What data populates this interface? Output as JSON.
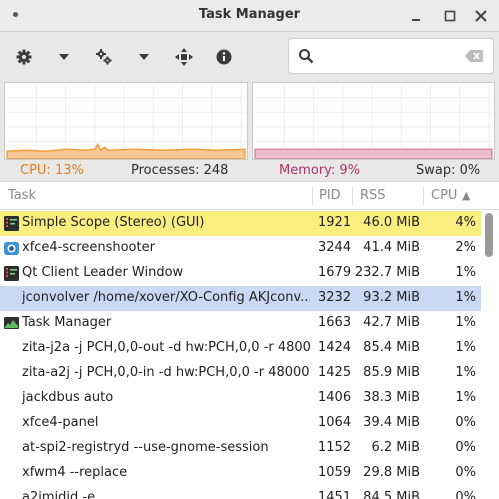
{
  "window": {
    "title": "Task Manager"
  },
  "toolbar": {
    "icons": [
      "gear-icon",
      "chevron-down-icon",
      "gears-icon",
      "chevron-down-icon",
      "crosshair-icon",
      "info-icon"
    ]
  },
  "search": {
    "value": "",
    "placeholder": ""
  },
  "status": {
    "cpu": "CPU: 13%",
    "processes": "Processes: 248",
    "memory": "Memory: 9%",
    "swap": "Swap: 0%"
  },
  "colors": {
    "cpu_graph": "#f39c3a",
    "memory_graph": "#d88aa0",
    "cpu_text": "#e67e22",
    "memory_text": "#b0306a",
    "highlight_yellow": "#fbee80",
    "highlight_blue": "#c9d9f3"
  },
  "table": {
    "columns": [
      "Task",
      "PID",
      "RSS",
      "CPU"
    ],
    "sort_indicator": "▲",
    "rows": [
      {
        "name": "Simple Scope (Stereo) (GUI)",
        "pid": "1921",
        "rss": "46.0 MiB",
        "cpu": "4%",
        "icon": "terminal-icon",
        "highlight": "yellow"
      },
      {
        "name": "xfce4-screenshooter",
        "pid": "3244",
        "rss": "41.4 MiB",
        "cpu": "2%",
        "icon": "camera-icon",
        "highlight": ""
      },
      {
        "name": "Qt Client Leader Window",
        "pid": "1679",
        "rss": "232.7 MiB",
        "cpu": "1%",
        "icon": "terminal-icon",
        "highlight": ""
      },
      {
        "name": "jconvolver /home/xover/XO-Config AKJconv...",
        "pid": "3232",
        "rss": "93.2 MiB",
        "cpu": "1%",
        "icon": "",
        "highlight": "blue"
      },
      {
        "name": "Task Manager",
        "pid": "1663",
        "rss": "42.7 MiB",
        "cpu": "1%",
        "icon": "monitor-icon",
        "highlight": ""
      },
      {
        "name": "zita-j2a -j PCH,0,0-out -d hw:PCH,0,0 -r 4800...",
        "pid": "1424",
        "rss": "85.4 MiB",
        "cpu": "1%",
        "icon": "",
        "highlight": ""
      },
      {
        "name": "zita-a2j -j PCH,0,0-in -d hw:PCH,0,0 -r 48000 -...",
        "pid": "1425",
        "rss": "85.9 MiB",
        "cpu": "1%",
        "icon": "",
        "highlight": ""
      },
      {
        "name": "jackdbus auto",
        "pid": "1406",
        "rss": "38.3 MiB",
        "cpu": "1%",
        "icon": "",
        "highlight": ""
      },
      {
        "name": "xfce4-panel",
        "pid": "1064",
        "rss": "39.4 MiB",
        "cpu": "0%",
        "icon": "",
        "highlight": ""
      },
      {
        "name": "at-spi2-registryd --use-gnome-session",
        "pid": "1152",
        "rss": "6.2 MiB",
        "cpu": "0%",
        "icon": "",
        "highlight": ""
      },
      {
        "name": "xfwm4 --replace",
        "pid": "1059",
        "rss": "29.8 MiB",
        "cpu": "0%",
        "icon": "",
        "highlight": ""
      },
      {
        "name": "a2jmidid -e",
        "pid": "1451",
        "rss": "84.5 MiB",
        "cpu": "0%",
        "icon": "",
        "highlight": ""
      }
    ]
  }
}
